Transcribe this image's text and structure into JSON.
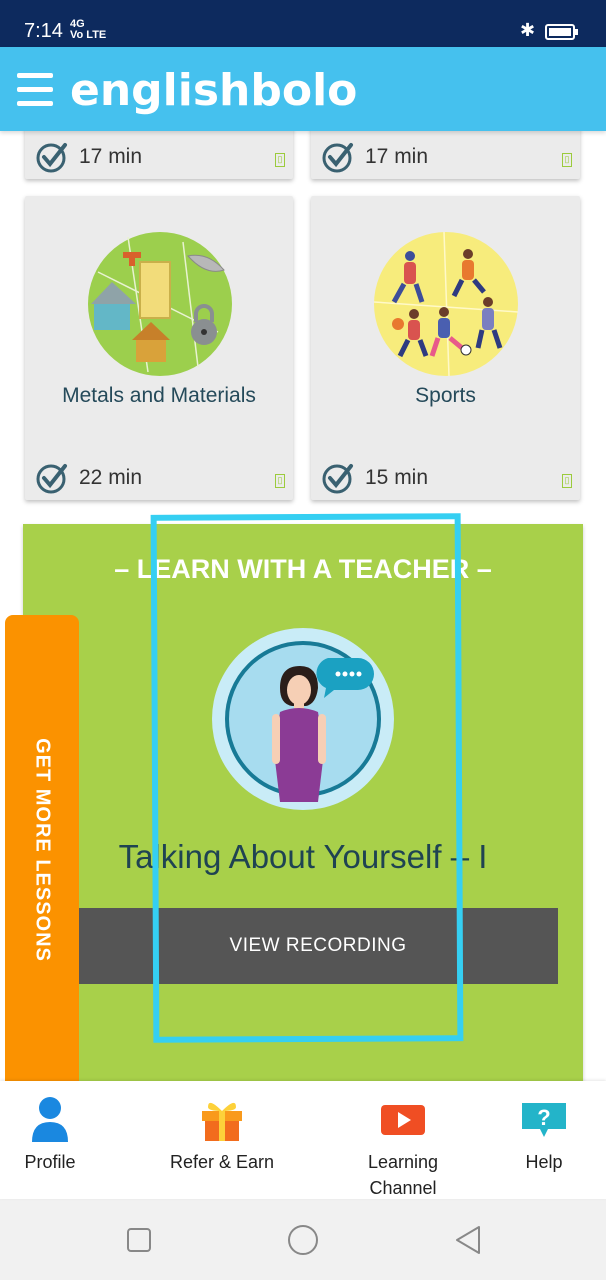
{
  "status_bar": {
    "time": "7:14",
    "network": "4G",
    "network2": "Vo LTE"
  },
  "app_bar": {
    "brand": "englishbolo"
  },
  "cards": [
    {
      "title": "",
      "time": "17 min"
    },
    {
      "title": "",
      "time": "17 min"
    },
    {
      "title": "Metals and Materials",
      "time": "22 min"
    },
    {
      "title": "Sports",
      "time": "15 min"
    }
  ],
  "teacher_section": {
    "heading": "– LEARN WITH A TEACHER –",
    "lesson_title": "Talking About Yourself  – I",
    "button_label": "VIEW RECORDING"
  },
  "side_tab": {
    "label": "GET MORE LESSONS"
  },
  "bottom_nav": [
    {
      "label": "Profile"
    },
    {
      "label": "Refer & Earn"
    },
    {
      "label": "Learning Channel"
    },
    {
      "label": "Help"
    }
  ],
  "colors": {
    "accent": "#45c1ee",
    "green_panel": "#a8d04a",
    "orange_tab": "#fb9200",
    "highlight": "#35cff2"
  }
}
